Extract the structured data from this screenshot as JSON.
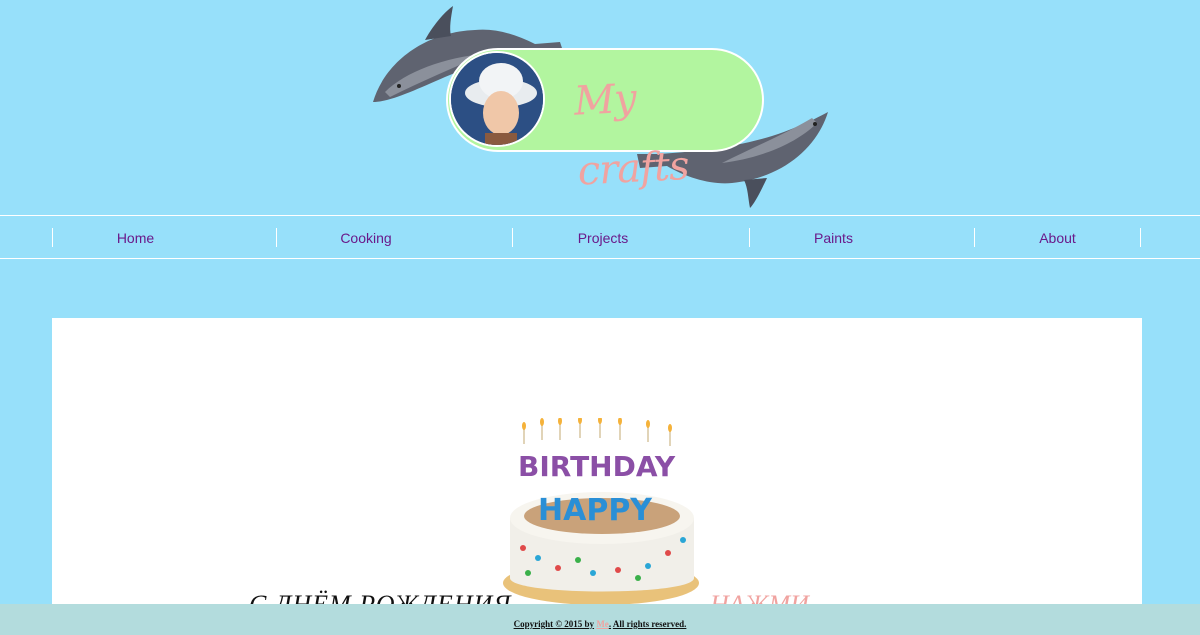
{
  "header": {
    "logo_text": "My crafts"
  },
  "nav": {
    "items": [
      {
        "label": "Home"
      },
      {
        "label": "Cooking"
      },
      {
        "label": "Projects"
      },
      {
        "label": "Paints"
      },
      {
        "label": "About"
      }
    ]
  },
  "content": {
    "cake": {
      "top_word": "BIRTHDAY",
      "bottom_word": "HAPPY"
    },
    "greeting": "С ДНЁМ РОЖДЕНИЯ",
    "click_link": "НАЖМИ"
  },
  "footer": {
    "prefix": "Copyright © 2015 by",
    "author": "Me",
    "suffix": "All rights reserved."
  },
  "colors": {
    "background": "#97e0fa",
    "nav_text": "#6a1a8a",
    "logo_pill": "#b2f59f",
    "accent_pink": "#f0a3a0",
    "footer_bg": "#b3dcdd"
  }
}
